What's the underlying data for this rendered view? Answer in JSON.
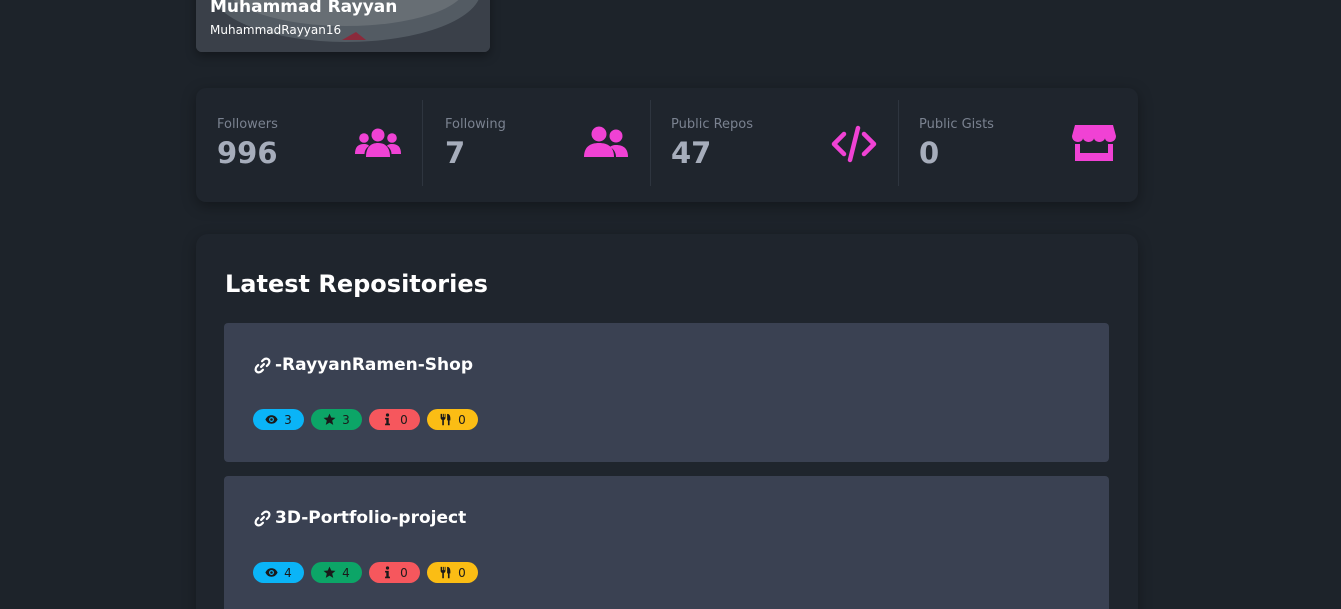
{
  "profile": {
    "name": "Muhammad Rayyan",
    "username": "MuhammadRayyan16"
  },
  "stats": [
    {
      "title": "Followers",
      "value": "996",
      "icon": "users-icon"
    },
    {
      "title": "Following",
      "value": "7",
      "icon": "user-friends-icon"
    },
    {
      "title": "Public Repos",
      "value": "47",
      "icon": "code-icon"
    },
    {
      "title": "Public Gists",
      "value": "0",
      "icon": "store-icon"
    }
  ],
  "repositories": {
    "title": "Latest Repositories",
    "items": [
      {
        "name": "-RayyanRamen-Shop",
        "watchers": "3",
        "stars": "3",
        "issues": "0",
        "forks": "0"
      },
      {
        "name": "3D-Portfolio-project",
        "watchers": "4",
        "stars": "4",
        "issues": "0",
        "forks": "0"
      }
    ]
  },
  "colors": {
    "background": "#1d232a",
    "card": "#1f252d",
    "repo_card": "#3a4152",
    "icon_accent": "#f042d4",
    "watch_badge": "#0ab4f7",
    "star_badge": "#0ca567",
    "issue_badge": "#f6575d",
    "fork_badge": "#fbbd14"
  }
}
